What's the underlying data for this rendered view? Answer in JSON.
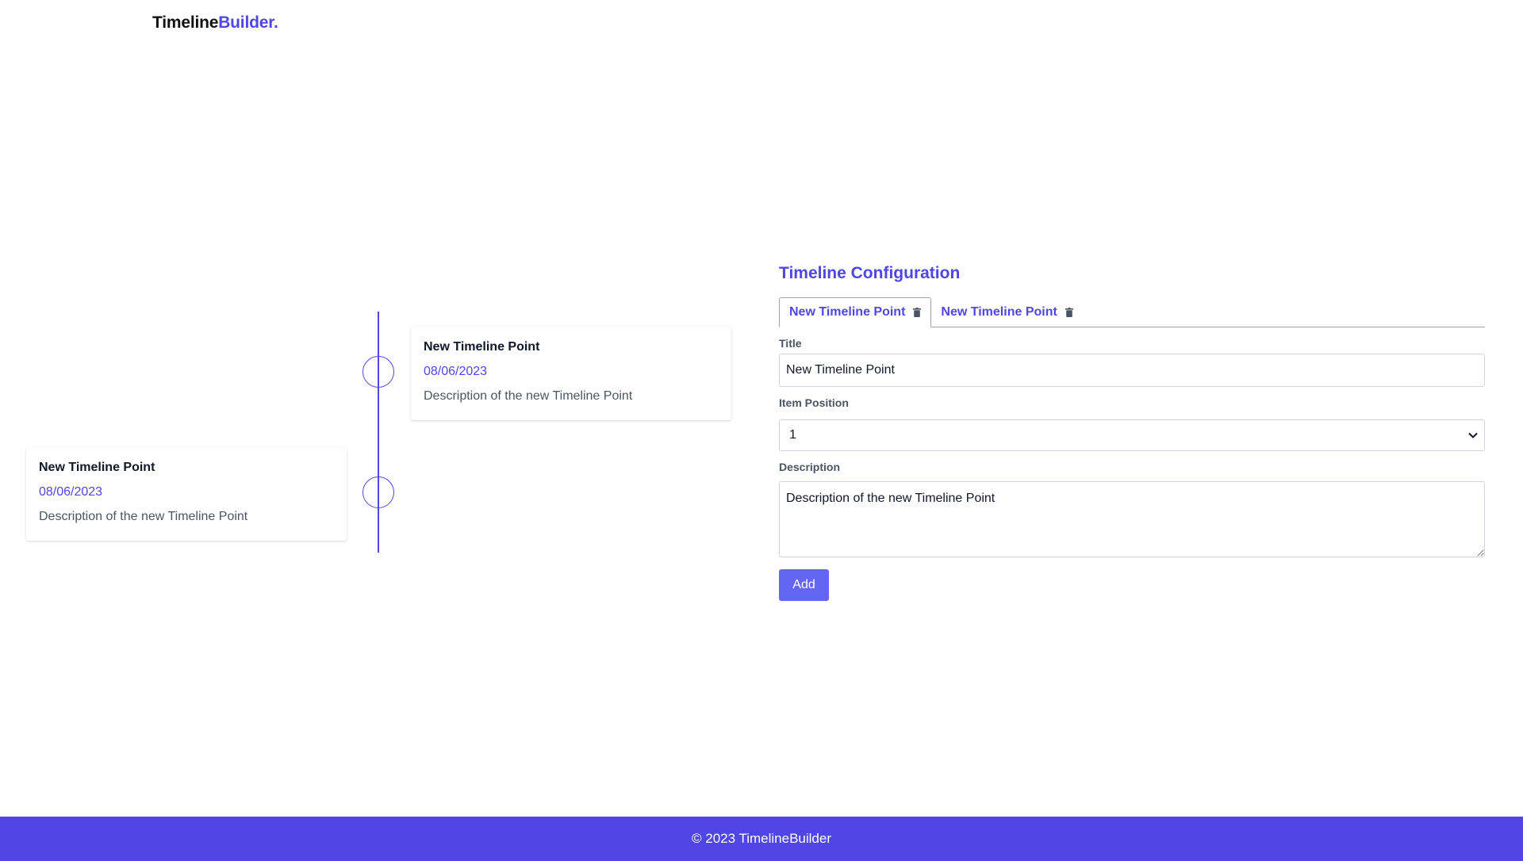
{
  "logo": {
    "part1": "Timeline",
    "part2": "Builder."
  },
  "timeline": {
    "items": [
      {
        "title": "New Timeline Point",
        "date": "08/06/2023",
        "description": "Description of the new Timeline Point"
      },
      {
        "title": "New Timeline Point",
        "date": "08/06/2023",
        "description": "Description of the new Timeline Point"
      }
    ]
  },
  "config": {
    "heading": "Timeline Configuration",
    "tabs": [
      {
        "label": "New Timeline Point",
        "icon": "trash-icon",
        "active": true
      },
      {
        "label": "New Timeline Point",
        "icon": "trash-icon",
        "active": false
      }
    ],
    "title_label": "Title",
    "title_value": "New Timeline Point",
    "position_label": "Item Position",
    "position_value": "1",
    "description_label": "Description",
    "description_value": "Description of the new Timeline Point",
    "add_label": "Add"
  },
  "footer": {
    "text": "© 2023 TimelineBuilder"
  },
  "colors": {
    "accent": "#4f46e5",
    "button": "#6366f1",
    "muted_text": "#4b5563"
  }
}
